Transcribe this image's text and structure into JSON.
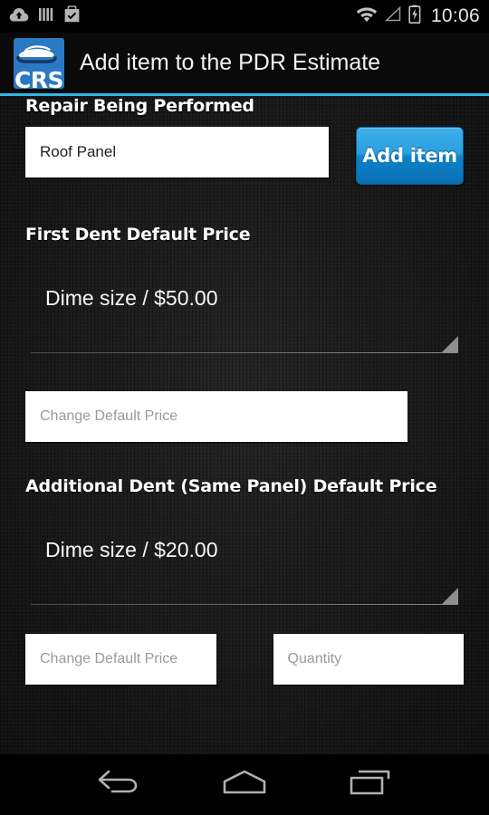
{
  "status_bar": {
    "icons_left": [
      "cloud-upload-icon",
      "barcode-icon",
      "shopping-bag-check-icon"
    ],
    "icons_right": [
      "wifi-icon",
      "cell-signal-icon",
      "battery-charging-icon"
    ],
    "clock": "10:06"
  },
  "action_bar": {
    "logo_text": "CRS",
    "logo_icon": "car-icon",
    "title": "Add item to the PDR Estimate",
    "accent_color": "#33b5e5"
  },
  "form": {
    "repair": {
      "label": "Repair Being Performed",
      "value": "Roof Panel",
      "button_label": "Add item",
      "button_color": "#1f93d6"
    },
    "first_dent": {
      "label": "First Dent Default Price",
      "spinner_value": "Dime size / $50.00",
      "price_placeholder": "Change Default Price"
    },
    "additional_dent": {
      "label": "Additional Dent (Same Panel) Default Price",
      "spinner_value": "Dime size / $20.00",
      "price_placeholder": "Change Default Price",
      "quantity_placeholder": "Quantity"
    }
  },
  "nav_bar": {
    "back": "back-icon",
    "home": "home-icon",
    "recents": "recents-icon"
  }
}
